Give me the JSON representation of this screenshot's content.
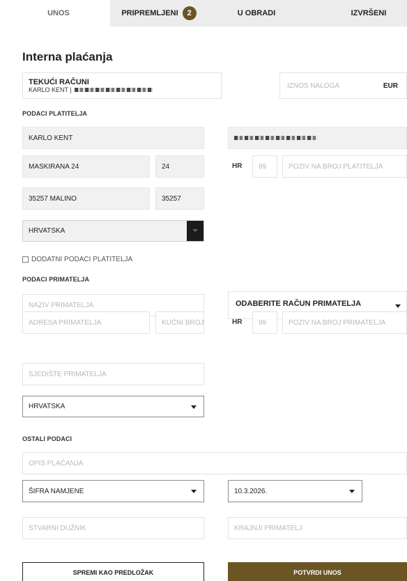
{
  "tabs": [
    {
      "label": "UNOS"
    },
    {
      "label": "PRIPREMLJENI",
      "badge": "2"
    },
    {
      "label": "U OBRADI"
    },
    {
      "label": "IZVRŠENI"
    }
  ],
  "page_title": "Interna plaćanja",
  "account": {
    "title": "TEKUĆI RAČUNI",
    "owner": "KARLO KENT |"
  },
  "amount": {
    "placeholder": "IZNOS NALOGA",
    "currency": "EUR"
  },
  "payer": {
    "section_label": "PODACI PLATITELJA",
    "name": "KARLO KENT",
    "street": "MASKIRANA 24",
    "house_number": "24",
    "model_prefix": "HR",
    "model_placeholder": "99",
    "reference_placeholder": "POZIV NA BROJ PLATITELJA",
    "city": "35257 MALINO",
    "postal_code": "35257",
    "country": "HRVATSKA",
    "extra_data_label": "DODATNI PODACI PLATITELJA"
  },
  "payee": {
    "section_label": "PODACI PRIMATELJA",
    "name_placeholder": "NAZIV PRIMATELJA",
    "account_select": "ODABERITE RAČUN PRIMATELJA",
    "address_placeholder": "ADRESA PRIMATELJA",
    "house_number_placeholder": "KUĆNI BROJ",
    "model_prefix": "HR",
    "model_placeholder": "99",
    "reference_placeholder": "POZIV NA BROJ PRIMATELJA",
    "seat_placeholder": "SJEDIŠTE PRIMATELJA",
    "country": "HRVATSKA"
  },
  "other": {
    "section_label": "OSTALI PODACI",
    "description_placeholder": "OPIS PLAĆANJA",
    "purpose_code": "ŠIFRA NAMJENE",
    "date": "10.3.2026.",
    "actual_debtor_placeholder": "STVARNI DUŽNIK",
    "final_payee_placeholder": "KRAJNJI PRIMATELJ"
  },
  "buttons": {
    "save_template": "SPREMI KAO PREDLOŽAK",
    "confirm": "POTVRDI UNOS"
  },
  "colors": {
    "accent": "#6b5524",
    "tab_bar": "#ececec",
    "filled_field": "#f1f1f1"
  }
}
